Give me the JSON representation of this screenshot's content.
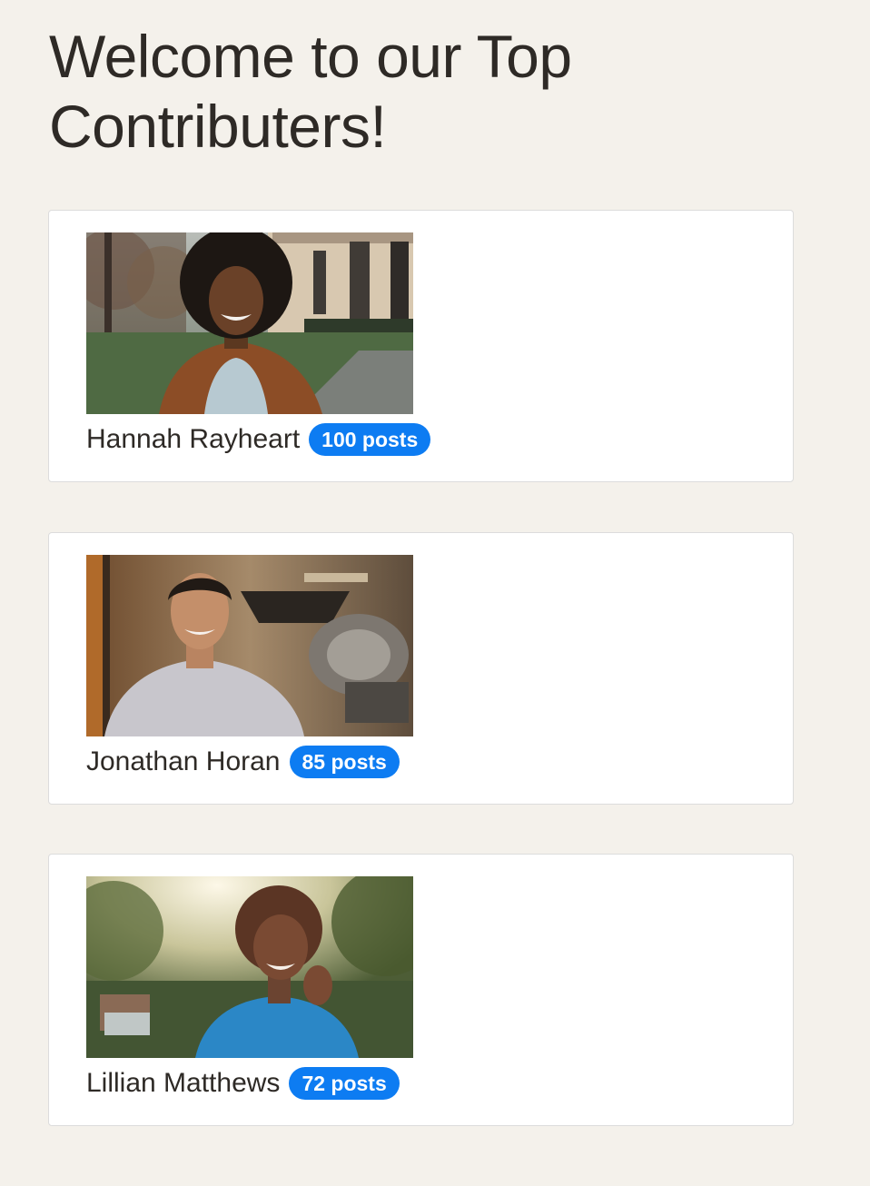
{
  "page": {
    "title": "Welcome to our Top Contributers!"
  },
  "contributors": [
    {
      "name": "Hannah Rayheart",
      "posts": "100 posts",
      "photo": "portrait-woman-brown-coat-street"
    },
    {
      "name": "Jonathan Horan",
      "posts": "85 posts",
      "photo": "portrait-man-grey-sweater-cafe"
    },
    {
      "name": "Lillian Matthews",
      "posts": "72 posts",
      "photo": "portrait-woman-blue-top-garden"
    }
  ],
  "colors": {
    "background": "#f4f1eb",
    "card": "#ffffff",
    "badge": "#0d7cf2",
    "text": "#2e2a26"
  }
}
